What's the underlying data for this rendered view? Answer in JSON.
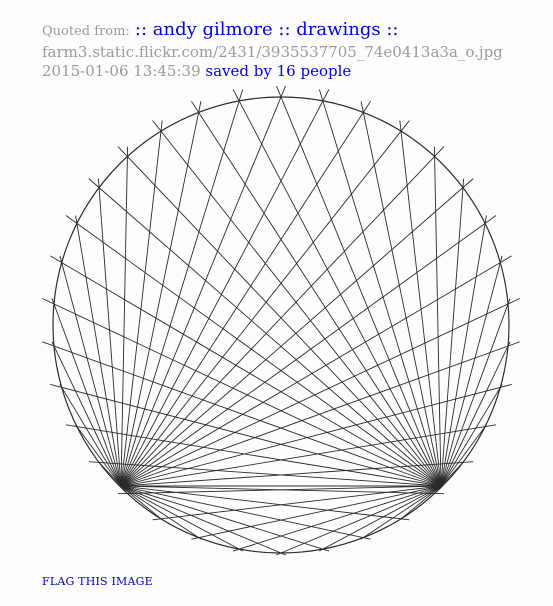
{
  "header": {
    "quoted_prefix": "Quoted from:",
    "quoted_title": ":: andy gilmore :: drawings ::",
    "source_url": "farm3.static.flickr.com/2431/3935537705_74e0413a3a_o.jpg",
    "timestamp": "2015-01-06 13:45:39",
    "saved_by": "saved by 16 people"
  },
  "footer": {
    "flag_label": "FLAG THIS IMAGE"
  },
  "colors": {
    "link": "#0000ee",
    "muted": "#9a9a9a",
    "ink": "#2a2a2a"
  }
}
